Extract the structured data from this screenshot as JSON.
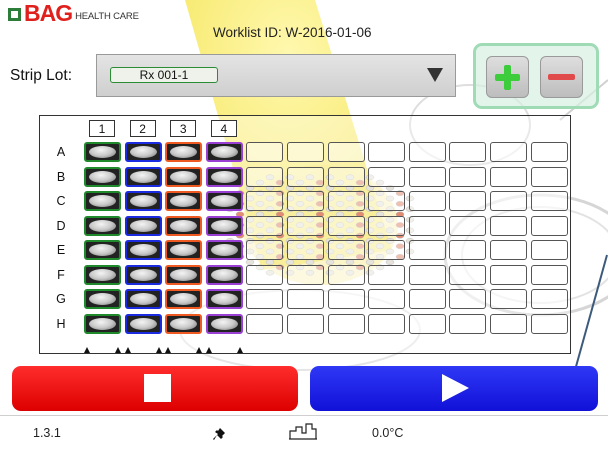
{
  "header": {
    "logo_brand": "BAG",
    "logo_sub": "HEALTH CARE",
    "worklist": "Worklist ID: W-2016-01-06"
  },
  "strip_lot": {
    "label": "Strip Lot:",
    "value": "Rx 001-1"
  },
  "controls": {
    "add_icon": "plus-icon",
    "remove_icon": "minus-icon"
  },
  "plate": {
    "columns": [
      "1",
      "2",
      "3",
      "4"
    ],
    "rows": [
      "A",
      "B",
      "C",
      "D",
      "E",
      "F",
      "G",
      "H"
    ],
    "strip_colors": [
      "#1f8a2c",
      "#1a2be0",
      "#ee5a22",
      "#9a3fd4"
    ],
    "total_columns": 12
  },
  "actions": {
    "stop_icon": "stop-icon",
    "start_icon": "play-icon",
    "stop_color": "#ff1a1a",
    "start_color": "#1a22e8"
  },
  "status": {
    "version": "1.3.1",
    "connection_icon": "plug-icon",
    "chart_icon": "temperature-curve-icon",
    "temperature": "0.0°C"
  }
}
